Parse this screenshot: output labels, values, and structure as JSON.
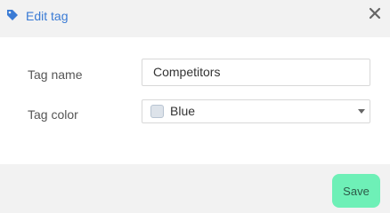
{
  "dialog": {
    "title": "Edit tag",
    "icon": "tag-icon",
    "close_icon": "close-icon"
  },
  "form": {
    "name_label": "Tag name",
    "name_value": "Competitors",
    "color_label": "Tag color",
    "color_value": "Blue",
    "color_swatch": "#dde3ea"
  },
  "footer": {
    "save_label": "Save"
  },
  "colors": {
    "accent": "#3a7bd5",
    "save_button": "#6ef0b7",
    "panel": "#f2f2f2"
  }
}
